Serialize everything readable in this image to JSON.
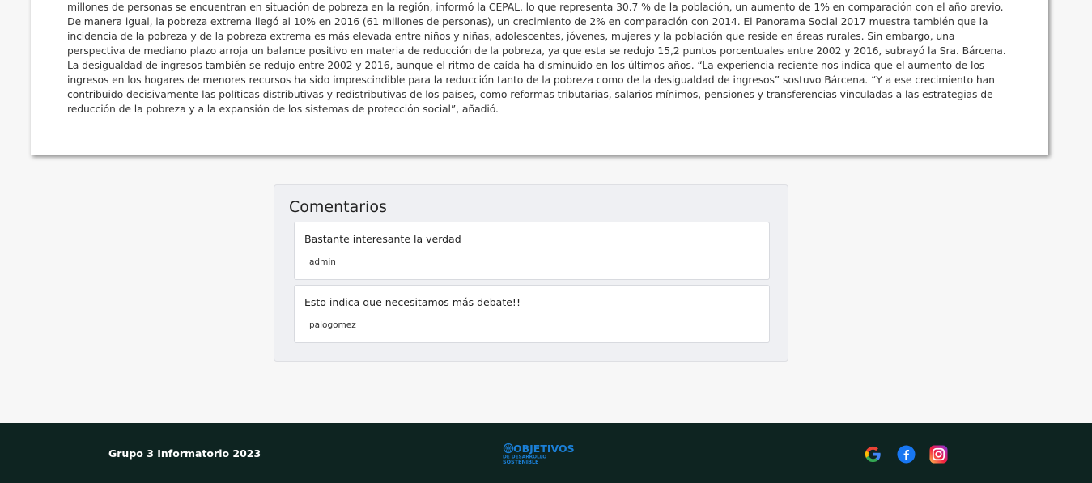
{
  "article": {
    "paragraph": "millones de personas se encuentran en situación de pobreza en la región, informó la CEPAL, lo que representa 30.7 % de la población, un aumento de 1% en comparación con el año previo. De manera igual, la pobreza extrema llegó al 10% en 2016 (61 millones de personas), un crecimiento de 2% en comparación con 2014. El Panorama Social 2017 muestra también que la incidencia de la pobreza y de la pobreza extrema es más elevada entre niños y niñas, adolescentes, jóvenes, mujeres y la población que reside en áreas rurales. Sin embargo, una perspectiva de mediano plazo arroja un balance positivo en materia de reducción de la pobreza, ya que esta se redujo 15,2 puntos porcentuales entre 2002 y 2016, subrayó la Sra. Bárcena. La desigualdad de ingresos también se redujo entre 2002 y 2016, aunque el ritmo de caída ha disminuido en los últimos años. “La experiencia reciente nos indica que el aumento de los ingresos en los hogares de menores recursos ha sido imprescindible para la reducción tanto de la pobreza como de la desigualdad de ingresos” sostuvo Bárcena. “Y a ese crecimiento han contribuido decisivamente las políticas distributivas y redistributivas de los países, como reformas tributarias, salarios mínimos, pensiones y transferencias vinculadas a las estrategias de reducción de la pobreza y a la expansión de los sistemas de protección social”, añadió."
  },
  "comments": {
    "title": "Comentarios",
    "items": [
      {
        "text": "Bastante interesante la verdad",
        "author": "admin"
      },
      {
        "text": "Esto indica que necesitamos más debate!!",
        "author": "palogomez"
      }
    ]
  },
  "footer": {
    "credit": "Grupo 3 Informatorio 2023",
    "logo": {
      "line1": "OBJETIVOS",
      "line2": "DE DESARROLLO",
      "line3": "SOSTENIBLE"
    },
    "social": [
      {
        "icon": "google-icon",
        "color": "#4285F4"
      },
      {
        "icon": "facebook-icon",
        "color": "#1877F2"
      },
      {
        "icon": "instagram-icon",
        "color": "#E1306C"
      }
    ]
  },
  "colors": {
    "footer_bg": "#0e2421",
    "comments_bg": "#eff0f3",
    "page_bg": "#f7f7f7"
  }
}
